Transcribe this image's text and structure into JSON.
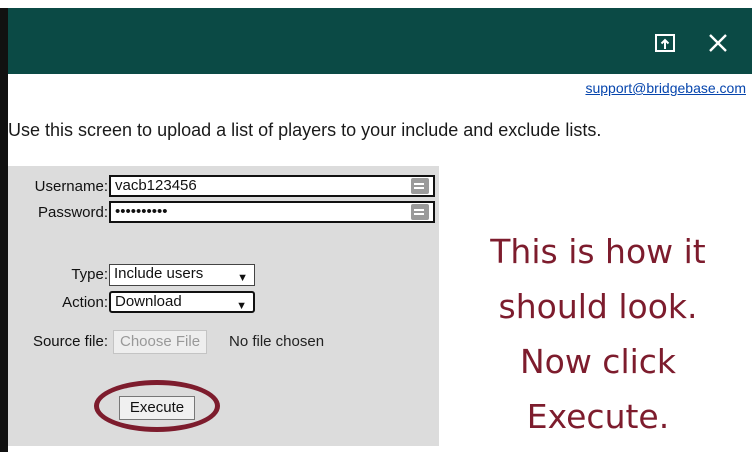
{
  "header": {
    "restore_icon": "restore-window-icon",
    "close_icon": "close-icon"
  },
  "support_link": "support@bridgebase.com",
  "intro": "Use this screen to upload a list of players to your include and exclude lists.",
  "form": {
    "username_label": "Username:",
    "username_value": "vacb123456",
    "password_label": "Password:",
    "password_value": "••••••••••",
    "type_label": "Type:",
    "type_value": "Include users",
    "action_label": "Action:",
    "action_value": "Download",
    "source_label": "Source file:",
    "choose_label": "Choose File",
    "no_file_text": "No file chosen",
    "execute_label": "Execute"
  },
  "hint_lines": [
    "This is how it",
    "should look.",
    "Now click",
    "Execute."
  ],
  "colors": {
    "header": "#0b4a45",
    "accent": "#7d1c2d",
    "panel": "#dcdcdc",
    "link": "#0645ad"
  }
}
